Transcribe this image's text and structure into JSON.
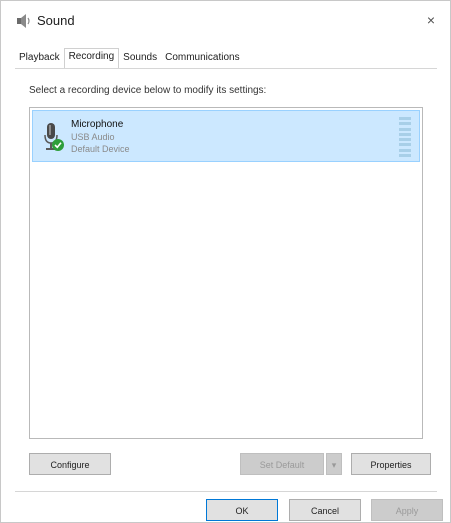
{
  "window": {
    "title": "Sound",
    "close_glyph": "×"
  },
  "tabs": [
    {
      "label": "Playback",
      "active": false
    },
    {
      "label": "Recording",
      "active": true
    },
    {
      "label": "Sounds",
      "active": false
    },
    {
      "label": "Communications",
      "active": false
    }
  ],
  "recording": {
    "instruction": "Select a recording device below to modify its settings:",
    "device": {
      "name": "Microphone",
      "line1": "USB Audio",
      "line2": "Default Device",
      "icon": "microphone-icon",
      "status_icon": "green-check-icon",
      "status_color": "#2e9e3a"
    }
  },
  "buttons": {
    "configure": "Configure",
    "set_default": "Set Default",
    "dropdown_glyph": "▾",
    "properties": "Properties",
    "ok": "OK",
    "cancel": "Cancel",
    "apply": "Apply"
  },
  "colors": {
    "selection_bg": "#cce8ff",
    "selection_border": "#99d1ff",
    "accent": "#0078d7"
  }
}
